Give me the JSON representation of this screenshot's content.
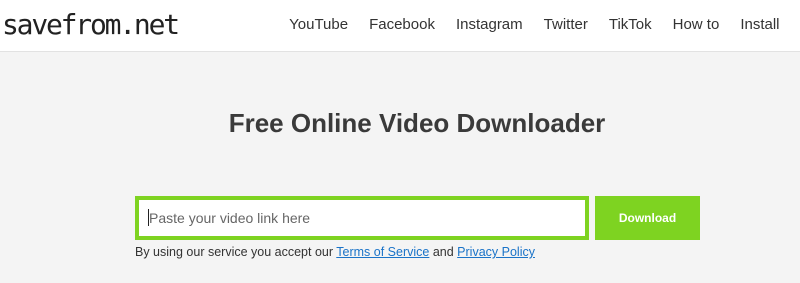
{
  "header": {
    "logo_text": "savefrom.net",
    "nav": [
      {
        "label": "YouTube"
      },
      {
        "label": "Facebook"
      },
      {
        "label": "Instagram"
      },
      {
        "label": "Twitter"
      },
      {
        "label": "TikTok"
      },
      {
        "label": "How to"
      },
      {
        "label": "Install"
      }
    ]
  },
  "main": {
    "title": "Free Online Video Downloader",
    "input": {
      "placeholder": "Paste your video link here",
      "value": ""
    },
    "download_label": "Download",
    "terms": {
      "prefix": "By using our service you accept our ",
      "tos_label": "Terms of Service",
      "middle": " and ",
      "privacy_label": "Privacy Policy"
    }
  },
  "colors": {
    "accent": "#7ed321",
    "link": "#1a73c8",
    "background": "#f4f4f4"
  }
}
